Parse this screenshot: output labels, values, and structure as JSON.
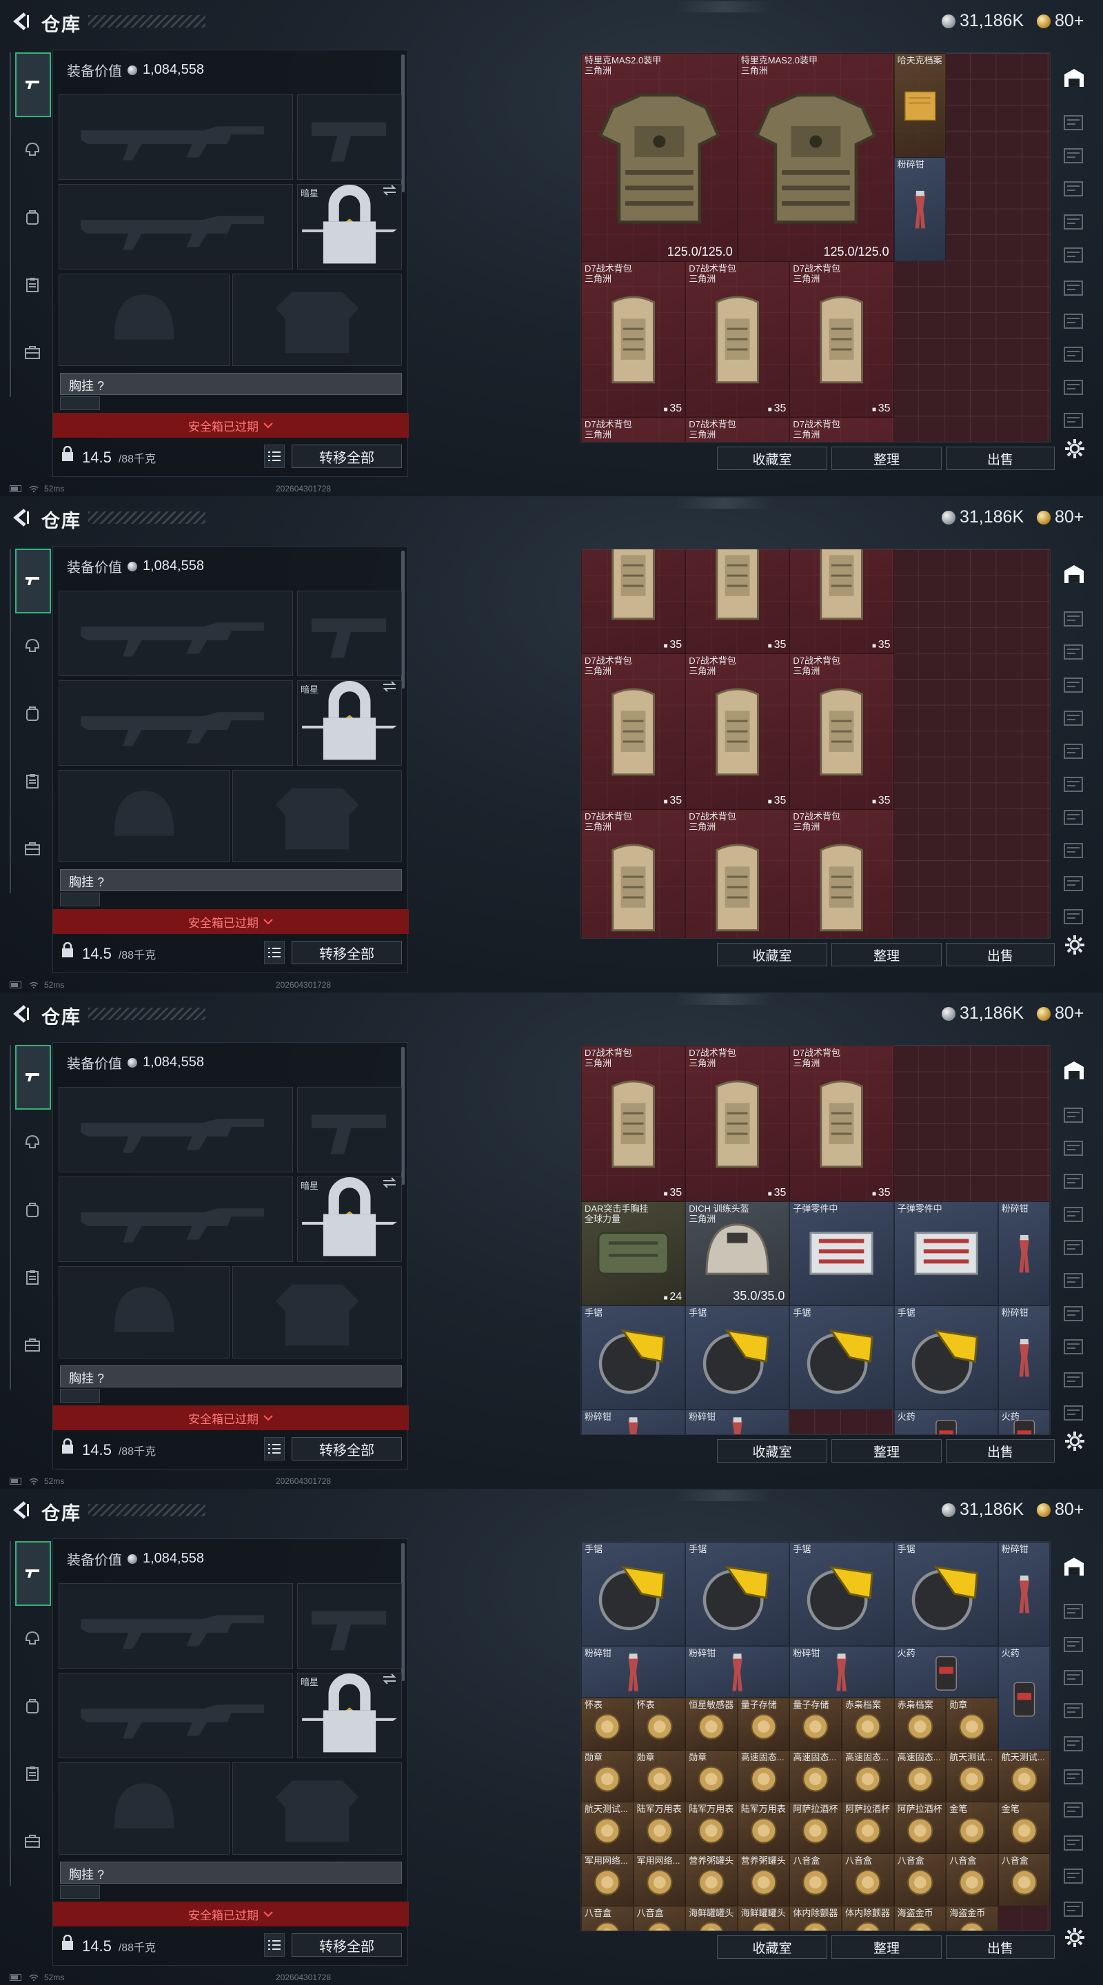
{
  "header": {
    "title": "仓库",
    "silver": "31,186K",
    "gold": "80+"
  },
  "loadout": {
    "value_label": "装备价值",
    "value": "1,084,558",
    "knife_name": "暗星",
    "chest_label": "胸挂 ?",
    "safebox_text": "安全箱已过期",
    "weight": "14.5",
    "weight_unit": "/88千克",
    "transfer_label": "转移全部"
  },
  "status": {
    "ping": "52ms",
    "timestamp": "202604301728"
  },
  "buttons": {
    "collection": "收藏室",
    "sort": "整理",
    "sell": "出售"
  },
  "colors": {
    "accent": "#2fb67a",
    "warning_red": "#7a1416"
  },
  "frames": [
    {
      "items": [
        {
          "name": "特里克MAS2.0装甲",
          "sub": "三角洲",
          "dur": "125.0/125.0",
          "kind": "armor",
          "bg": "red",
          "c": 0,
          "r": 0,
          "w": 3,
          "h": 4
        },
        {
          "name": "特里克MAS2.0装甲",
          "sub": "三角洲",
          "dur": "125.0/125.0",
          "kind": "armor",
          "bg": "red",
          "c": 3,
          "r": 0,
          "w": 3,
          "h": 4
        },
        {
          "name": "哈夫克档案",
          "sub": "",
          "kind": "file",
          "bg": "brown",
          "c": 6,
          "r": 0,
          "w": 1,
          "h": 2
        },
        {
          "name": "粉碎钳",
          "sub": "",
          "kind": "pliers",
          "bg": "slate",
          "c": 6,
          "r": 2,
          "w": 1,
          "h": 2
        },
        {
          "name": "D7战术背包",
          "sub": "三角洲",
          "cap": "35",
          "kind": "bag",
          "bg": "red",
          "c": 0,
          "r": 4,
          "w": 2,
          "h": 3
        },
        {
          "name": "D7战术背包",
          "sub": "三角洲",
          "cap": "35",
          "kind": "bag",
          "bg": "red",
          "c": 2,
          "r": 4,
          "w": 2,
          "h": 3
        },
        {
          "name": "D7战术背包",
          "sub": "三角洲",
          "cap": "35",
          "kind": "bag",
          "bg": "red",
          "c": 4,
          "r": 4,
          "w": 2,
          "h": 3
        },
        {
          "name": "D7战术背包",
          "sub": "三角洲",
          "kind": "bag",
          "bg": "red",
          "c": 0,
          "r": 7,
          "w": 2,
          "h": 3
        },
        {
          "name": "D7战术背包",
          "sub": "三角洲",
          "kind": "bag",
          "bg": "red",
          "c": 2,
          "r": 7,
          "w": 2,
          "h": 3
        },
        {
          "name": "D7战术背包",
          "sub": "三角洲",
          "kind": "bag",
          "bg": "red",
          "c": 4,
          "r": 7,
          "w": 2,
          "h": 3
        }
      ]
    },
    {
      "items": [
        {
          "name": "",
          "sub": "",
          "cap": "35",
          "kind": "bag",
          "bg": "red",
          "c": 0,
          "r": -1,
          "w": 2,
          "h": 3
        },
        {
          "name": "",
          "sub": "",
          "cap": "35",
          "kind": "bag",
          "bg": "red",
          "c": 2,
          "r": -1,
          "w": 2,
          "h": 3
        },
        {
          "name": "",
          "sub": "",
          "cap": "35",
          "kind": "bag",
          "bg": "red",
          "c": 4,
          "r": -1,
          "w": 2,
          "h": 3
        },
        {
          "name": "D7战术背包",
          "sub": "三角洲",
          "cap": "35",
          "kind": "bag",
          "bg": "red",
          "c": 0,
          "r": 2,
          "w": 2,
          "h": 3
        },
        {
          "name": "D7战术背包",
          "sub": "三角洲",
          "cap": "35",
          "kind": "bag",
          "bg": "red",
          "c": 2,
          "r": 2,
          "w": 2,
          "h": 3
        },
        {
          "name": "D7战术背包",
          "sub": "三角洲",
          "cap": "35",
          "kind": "bag",
          "bg": "red",
          "c": 4,
          "r": 2,
          "w": 2,
          "h": 3
        },
        {
          "name": "D7战术背包",
          "sub": "三角洲",
          "kind": "bag",
          "bg": "red",
          "c": 0,
          "r": 5,
          "w": 2,
          "h": 3
        },
        {
          "name": "D7战术背包",
          "sub": "三角洲",
          "kind": "bag",
          "bg": "red",
          "c": 2,
          "r": 5,
          "w": 2,
          "h": 3
        },
        {
          "name": "D7战术背包",
          "sub": "三角洲",
          "kind": "bag",
          "bg": "red",
          "c": 4,
          "r": 5,
          "w": 2,
          "h": 3
        }
      ]
    },
    {
      "items": [
        {
          "name": "D7战术背包",
          "sub": "三角洲",
          "cap": "35",
          "kind": "bag",
          "bg": "red",
          "c": 0,
          "r": 0,
          "w": 2,
          "h": 3
        },
        {
          "name": "D7战术背包",
          "sub": "三角洲",
          "cap": "35",
          "kind": "bag",
          "bg": "red",
          "c": 2,
          "r": 0,
          "w": 2,
          "h": 3
        },
        {
          "name": "D7战术背包",
          "sub": "三角洲",
          "cap": "35",
          "kind": "bag",
          "bg": "red",
          "c": 4,
          "r": 0,
          "w": 2,
          "h": 3
        },
        {
          "name": "DAR突击手胸挂",
          "sub": "全球力量",
          "cap": "24",
          "kind": "rig",
          "bg": "olive",
          "c": 0,
          "r": 3,
          "w": 2,
          "h": 2
        },
        {
          "name": "DICH 训练头盔",
          "sub": "三角洲",
          "dur": "35.0/35.0",
          "kind": "helmet",
          "bg": "gray",
          "c": 2,
          "r": 3,
          "w": 2,
          "h": 2
        },
        {
          "name": "子弹零件中",
          "sub": "",
          "kind": "ammo",
          "bg": "slate",
          "c": 4,
          "r": 3,
          "w": 2,
          "h": 2
        },
        {
          "name": "子弹零件中",
          "sub": "",
          "kind": "ammo",
          "bg": "slate",
          "c": 6,
          "r": 3,
          "w": 2,
          "h": 2
        },
        {
          "name": "粉碎钳",
          "sub": "",
          "kind": "pliers",
          "bg": "slate",
          "c": 8,
          "r": 3,
          "w": 1,
          "h": 2
        },
        {
          "name": "手锯",
          "sub": "",
          "kind": "saw",
          "bg": "slate",
          "c": 0,
          "r": 5,
          "w": 2,
          "h": 2
        },
        {
          "name": "手锯",
          "sub": "",
          "kind": "saw",
          "bg": "slate",
          "c": 2,
          "r": 5,
          "w": 2,
          "h": 2
        },
        {
          "name": "手锯",
          "sub": "",
          "kind": "saw",
          "bg": "slate",
          "c": 4,
          "r": 5,
          "w": 2,
          "h": 2
        },
        {
          "name": "手锯",
          "sub": "",
          "kind": "saw",
          "bg": "slate",
          "c": 6,
          "r": 5,
          "w": 2,
          "h": 2
        },
        {
          "name": "粉碎钳",
          "sub": "",
          "kind": "pliers",
          "bg": "slate",
          "c": 8,
          "r": 5,
          "w": 1,
          "h": 2
        },
        {
          "name": "粉碎钳",
          "sub": "",
          "kind": "pliers",
          "bg": "slate",
          "c": 0,
          "r": 7,
          "w": 2,
          "h": 1
        },
        {
          "name": "粉碎钳",
          "sub": "",
          "kind": "pliers",
          "bg": "slate",
          "c": 2,
          "r": 7,
          "w": 2,
          "h": 1
        },
        {
          "name": "火药",
          "sub": "",
          "kind": "powder",
          "bg": "slate",
          "c": 6,
          "r": 7,
          "w": 2,
          "h": 1
        },
        {
          "name": "火药",
          "sub": "",
          "kind": "powder",
          "bg": "slate",
          "c": 8,
          "r": 7,
          "w": 1,
          "h": 1
        }
      ]
    },
    {
      "items": [
        {
          "name": "手锯",
          "sub": "",
          "kind": "saw",
          "bg": "slate",
          "c": 0,
          "r": 0,
          "w": 2,
          "h": 2
        },
        {
          "name": "手锯",
          "sub": "",
          "kind": "saw",
          "bg": "slate",
          "c": 2,
          "r": 0,
          "w": 2,
          "h": 2
        },
        {
          "name": "手锯",
          "sub": "",
          "kind": "saw",
          "bg": "slate",
          "c": 4,
          "r": 0,
          "w": 2,
          "h": 2
        },
        {
          "name": "手锯",
          "sub": "",
          "kind": "saw",
          "bg": "slate",
          "c": 6,
          "r": 0,
          "w": 2,
          "h": 2
        },
        {
          "name": "粉碎钳",
          "sub": "",
          "kind": "pliers",
          "bg": "slate",
          "c": 8,
          "r": 0,
          "w": 1,
          "h": 2
        },
        {
          "name": "粉碎钳",
          "sub": "",
          "kind": "pliers",
          "bg": "slate",
          "c": 0,
          "r": 2,
          "w": 2,
          "h": 1
        },
        {
          "name": "粉碎钳",
          "sub": "",
          "kind": "pliers",
          "bg": "slate",
          "c": 2,
          "r": 2,
          "w": 2,
          "h": 1
        },
        {
          "name": "粉碎钳",
          "sub": "",
          "kind": "pliers",
          "bg": "slate",
          "c": 4,
          "r": 2,
          "w": 2,
          "h": 1
        },
        {
          "name": "火药",
          "sub": "",
          "kind": "powder",
          "bg": "slate",
          "c": 6,
          "r": 2,
          "w": 2,
          "h": 1
        },
        {
          "name": "火药",
          "sub": "",
          "kind": "powder",
          "bg": "slate",
          "c": 8,
          "r": 2,
          "w": 1,
          "h": 2
        },
        {
          "name": "怀表",
          "sub": "",
          "kind": "misc",
          "bg": "brown",
          "c": 0,
          "r": 3,
          "w": 1,
          "h": 1
        },
        {
          "name": "怀表",
          "sub": "",
          "kind": "misc",
          "bg": "brown",
          "c": 1,
          "r": 3,
          "w": 1,
          "h": 1
        },
        {
          "name": "恒星敏感器",
          "sub": "",
          "kind": "misc",
          "bg": "brown",
          "c": 2,
          "r": 3,
          "w": 1,
          "h": 1
        },
        {
          "name": "量子存储",
          "sub": "",
          "kind": "misc",
          "bg": "brown",
          "c": 3,
          "r": 3,
          "w": 1,
          "h": 1
        },
        {
          "name": "量子存储",
          "sub": "",
          "kind": "misc",
          "bg": "brown",
          "c": 4,
          "r": 3,
          "w": 1,
          "h": 1
        },
        {
          "name": "赤枭档案",
          "sub": "",
          "kind": "misc",
          "bg": "brown",
          "c": 5,
          "r": 3,
          "w": 1,
          "h": 1
        },
        {
          "name": "赤枭档案",
          "sub": "",
          "kind": "misc",
          "bg": "brown",
          "c": 6,
          "r": 3,
          "w": 1,
          "h": 1
        },
        {
          "name": "勋章",
          "sub": "",
          "kind": "misc",
          "bg": "brown",
          "c": 7,
          "r": 3,
          "w": 1,
          "h": 1
        },
        {
          "name": "勋章",
          "sub": "",
          "kind": "misc",
          "bg": "brown",
          "c": 0,
          "r": 4,
          "w": 1,
          "h": 1
        },
        {
          "name": "勋章",
          "sub": "",
          "kind": "misc",
          "bg": "brown",
          "c": 1,
          "r": 4,
          "w": 1,
          "h": 1
        },
        {
          "name": "勋章",
          "sub": "",
          "kind": "misc",
          "bg": "brown",
          "c": 2,
          "r": 4,
          "w": 1,
          "h": 1
        },
        {
          "name": "高速固态...",
          "sub": "",
          "kind": "misc",
          "bg": "brown",
          "c": 3,
          "r": 4,
          "w": 1,
          "h": 1
        },
        {
          "name": "高速固态...",
          "sub": "",
          "kind": "misc",
          "bg": "brown",
          "c": 4,
          "r": 4,
          "w": 1,
          "h": 1
        },
        {
          "name": "高速固态...",
          "sub": "",
          "kind": "misc",
          "bg": "brown",
          "c": 5,
          "r": 4,
          "w": 1,
          "h": 1
        },
        {
          "name": "高速固态...",
          "sub": "",
          "kind": "misc",
          "bg": "brown",
          "c": 6,
          "r": 4,
          "w": 1,
          "h": 1
        },
        {
          "name": "航天测试...",
          "sub": "",
          "kind": "misc",
          "bg": "brown",
          "c": 7,
          "r": 4,
          "w": 1,
          "h": 1
        },
        {
          "name": "航天测试...",
          "sub": "",
          "kind": "misc",
          "bg": "brown",
          "c": 8,
          "r": 4,
          "w": 1,
          "h": 1
        },
        {
          "name": "航天测试...",
          "sub": "",
          "kind": "misc",
          "bg": "brown",
          "c": 0,
          "r": 5,
          "w": 1,
          "h": 1
        },
        {
          "name": "陆军万用表",
          "sub": "",
          "kind": "misc",
          "bg": "brown",
          "c": 1,
          "r": 5,
          "w": 1,
          "h": 1
        },
        {
          "name": "陆军万用表",
          "sub": "",
          "kind": "misc",
          "bg": "brown",
          "c": 2,
          "r": 5,
          "w": 1,
          "h": 1
        },
        {
          "name": "陆军万用表",
          "sub": "",
          "kind": "misc",
          "bg": "brown",
          "c": 3,
          "r": 5,
          "w": 1,
          "h": 1
        },
        {
          "name": "阿萨拉酒杯",
          "sub": "",
          "kind": "misc",
          "bg": "brown",
          "c": 4,
          "r": 5,
          "w": 1,
          "h": 1
        },
        {
          "name": "阿萨拉酒杯",
          "sub": "",
          "kind": "misc",
          "bg": "brown",
          "c": 5,
          "r": 5,
          "w": 1,
          "h": 1
        },
        {
          "name": "阿萨拉酒杯",
          "sub": "",
          "kind": "misc",
          "bg": "brown",
          "c": 6,
          "r": 5,
          "w": 1,
          "h": 1
        },
        {
          "name": "金笔",
          "sub": "",
          "kind": "misc",
          "bg": "brown",
          "c": 7,
          "r": 5,
          "w": 1,
          "h": 1
        },
        {
          "name": "金笔",
          "sub": "",
          "kind": "misc",
          "bg": "brown",
          "c": 8,
          "r": 5,
          "w": 1,
          "h": 1
        },
        {
          "name": "军用网络...",
          "sub": "",
          "kind": "misc",
          "bg": "brown",
          "c": 0,
          "r": 6,
          "w": 1,
          "h": 1
        },
        {
          "name": "军用网络...",
          "sub": "",
          "kind": "misc",
          "bg": "brown",
          "c": 1,
          "r": 6,
          "w": 1,
          "h": 1
        },
        {
          "name": "营养粥罐头",
          "sub": "",
          "kind": "misc",
          "bg": "brown",
          "c": 2,
          "r": 6,
          "w": 1,
          "h": 1
        },
        {
          "name": "营养粥罐头",
          "sub": "",
          "kind": "misc",
          "bg": "brown",
          "c": 3,
          "r": 6,
          "w": 1,
          "h": 1
        },
        {
          "name": "八音盒",
          "sub": "",
          "kind": "misc",
          "bg": "brown",
          "c": 4,
          "r": 6,
          "w": 1,
          "h": 1
        },
        {
          "name": "八音盒",
          "sub": "",
          "kind": "misc",
          "bg": "brown",
          "c": 5,
          "r": 6,
          "w": 1,
          "h": 1
        },
        {
          "name": "八音盒",
          "sub": "",
          "kind": "misc",
          "bg": "brown",
          "c": 6,
          "r": 6,
          "w": 1,
          "h": 1
        },
        {
          "name": "八音盒",
          "sub": "",
          "kind": "misc",
          "bg": "brown",
          "c": 7,
          "r": 6,
          "w": 1,
          "h": 1
        },
        {
          "name": "八音盒",
          "sub": "",
          "kind": "misc",
          "bg": "brown",
          "c": 8,
          "r": 6,
          "w": 1,
          "h": 1
        },
        {
          "name": "八音盒",
          "sub": "",
          "kind": "misc",
          "bg": "brown",
          "c": 0,
          "r": 7,
          "w": 1,
          "h": 1
        },
        {
          "name": "八音盒",
          "sub": "",
          "kind": "misc",
          "bg": "brown",
          "c": 1,
          "r": 7,
          "w": 1,
          "h": 1
        },
        {
          "name": "海鲜罐罐头",
          "sub": "",
          "kind": "misc",
          "bg": "brown",
          "c": 2,
          "r": 7,
          "w": 1,
          "h": 1
        },
        {
          "name": "海鲜罐罐头",
          "sub": "",
          "kind": "misc",
          "bg": "brown",
          "c": 3,
          "r": 7,
          "w": 1,
          "h": 1
        },
        {
          "name": "体内除颤器",
          "sub": "",
          "kind": "misc",
          "bg": "brown",
          "c": 4,
          "r": 7,
          "w": 1,
          "h": 1
        },
        {
          "name": "体内除颤器",
          "sub": "",
          "kind": "misc",
          "bg": "brown",
          "c": 5,
          "r": 7,
          "w": 1,
          "h": 1
        },
        {
          "name": "海盗金币",
          "sub": "",
          "kind": "misc",
          "bg": "brown",
          "c": 6,
          "r": 7,
          "w": 1,
          "h": 1
        },
        {
          "name": "海盗金币",
          "sub": "",
          "kind": "misc",
          "bg": "brown",
          "c": 7,
          "r": 7,
          "w": 1,
          "h": 1
        }
      ]
    }
  ]
}
